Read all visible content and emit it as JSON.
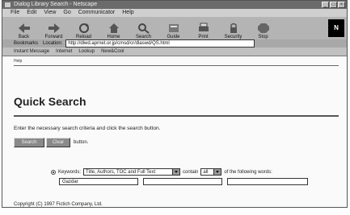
{
  "window": {
    "title": "Dialog Library Search - Netscape"
  },
  "menu": [
    "File",
    "Edit",
    "View",
    "Go",
    "Communicator",
    "Help"
  ],
  "toolbar": [
    {
      "label": "Back",
      "icon": "back-arrow-icon"
    },
    {
      "label": "Forward",
      "icon": "forward-arrow-icon"
    },
    {
      "label": "Reload",
      "icon": "reload-icon"
    },
    {
      "label": "Home",
      "icon": "home-icon"
    },
    {
      "label": "Search",
      "icon": "search-icon"
    },
    {
      "label": "Guide",
      "icon": "guide-icon"
    },
    {
      "label": "Print",
      "icon": "print-icon"
    },
    {
      "label": "Security",
      "icon": "lock-icon"
    },
    {
      "label": "Stop",
      "icon": "stop-icon"
    }
  ],
  "location": {
    "bookmarks_label": "Bookmarks",
    "location_label": "Location:",
    "url": "http://dlwd.aprnet.or.jp/cmsd/cr/dlaswd/QS.html"
  },
  "directory": [
    "Instant Message",
    "Internet",
    "Lookup",
    "New&Cool"
  ],
  "page": {
    "note": "Help",
    "title": "Quick Search",
    "instruction": "Enter the necessary search criteria and click the search button.",
    "search_button": "Search",
    "clear_button": "Clear",
    "button_note": "button.",
    "keywords_label": "Keywords:",
    "field_select": "Title, Authors, TOC and Full Text",
    "contain_label": "contain",
    "contain_select": "all",
    "tail_text": "of the following words:",
    "keyword_values": [
      "Gazdar",
      "",
      ""
    ],
    "copyright": "Copyright (C) 1997 Fictich Company, Ltd."
  }
}
